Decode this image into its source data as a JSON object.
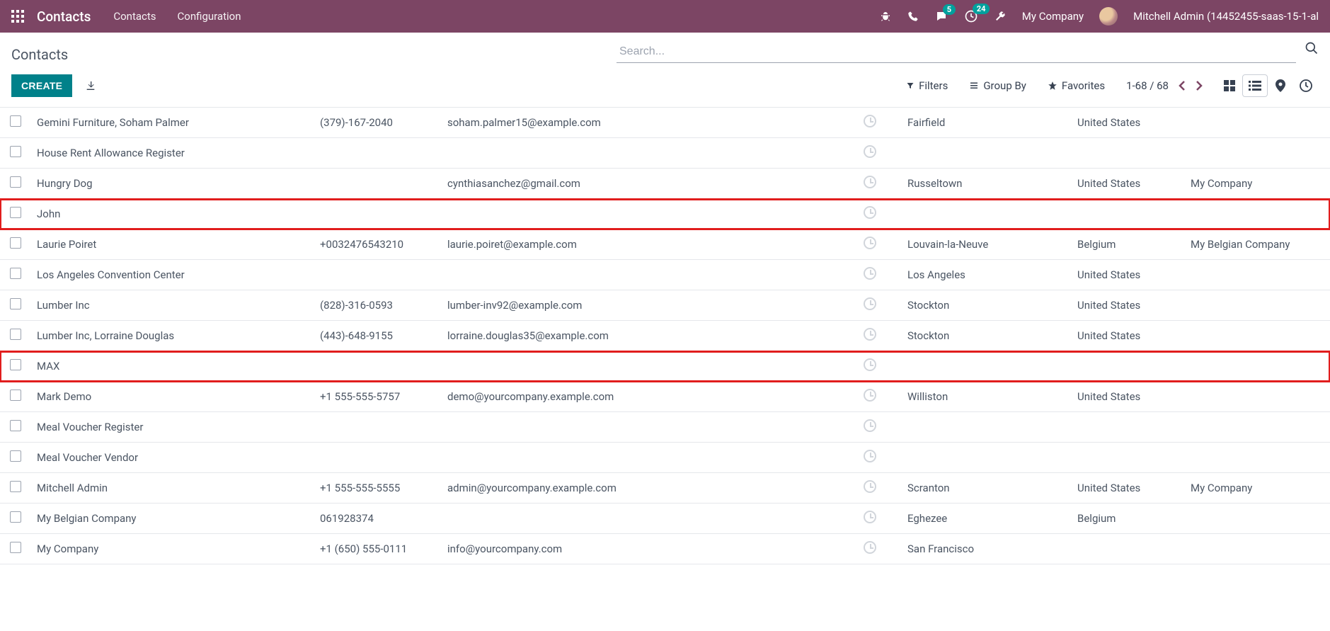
{
  "topbar": {
    "brand": "Contacts",
    "nav": {
      "contacts": "Contacts",
      "configuration": "Configuration"
    },
    "messaging_badge": "5",
    "activity_badge": "24",
    "company": "My Company",
    "user": "Mitchell Admin (14452455-saas-15-1-al"
  },
  "header": {
    "title": "Contacts",
    "search_placeholder": "Search..."
  },
  "toolbar": {
    "create": "CREATE",
    "filters": "Filters",
    "groupby": "Group By",
    "favorites": "Favorites",
    "pager": "1-68 / 68"
  },
  "rows": [
    {
      "name": "Gemini Furniture, Soham Palmer",
      "phone": "(379)-167-2040",
      "email": "soham.palmer15@example.com",
      "city": "Fairfield",
      "country": "United States",
      "company": "",
      "hl": false
    },
    {
      "name": "House Rent Allowance Register",
      "phone": "",
      "email": "",
      "city": "",
      "country": "",
      "company": "",
      "hl": false
    },
    {
      "name": "Hungry Dog",
      "phone": "",
      "email": "cynthiasanchez@gmail.com",
      "city": "Russeltown",
      "country": "United States",
      "company": "My Company",
      "hl": false
    },
    {
      "name": "John",
      "phone": "",
      "email": "",
      "city": "",
      "country": "",
      "company": "",
      "hl": true
    },
    {
      "name": "Laurie Poiret",
      "phone": "+0032476543210",
      "email": "laurie.poiret@example.com",
      "city": "Louvain-la-Neuve",
      "country": "Belgium",
      "company": "My Belgian Company",
      "hl": false
    },
    {
      "name": "Los Angeles Convention Center",
      "phone": "",
      "email": "",
      "city": "Los Angeles",
      "country": "United States",
      "company": "",
      "hl": false
    },
    {
      "name": "Lumber Inc",
      "phone": "(828)-316-0593",
      "email": "lumber-inv92@example.com",
      "city": "Stockton",
      "country": "United States",
      "company": "",
      "hl": false
    },
    {
      "name": "Lumber Inc, Lorraine Douglas",
      "phone": "(443)-648-9155",
      "email": "lorraine.douglas35@example.com",
      "city": "Stockton",
      "country": "United States",
      "company": "",
      "hl": false
    },
    {
      "name": "MAX",
      "phone": "",
      "email": "",
      "city": "",
      "country": "",
      "company": "",
      "hl": true
    },
    {
      "name": "Mark Demo",
      "phone": "+1 555-555-5757",
      "email": "demo@yourcompany.example.com",
      "city": "Williston",
      "country": "United States",
      "company": "",
      "hl": false
    },
    {
      "name": "Meal Voucher Register",
      "phone": "",
      "email": "",
      "city": "",
      "country": "",
      "company": "",
      "hl": false
    },
    {
      "name": "Meal Voucher Vendor",
      "phone": "",
      "email": "",
      "city": "",
      "country": "",
      "company": "",
      "hl": false
    },
    {
      "name": "Mitchell Admin",
      "phone": "+1 555-555-5555",
      "email": "admin@yourcompany.example.com",
      "city": "Scranton",
      "country": "United States",
      "company": "My Company",
      "hl": false
    },
    {
      "name": "My Belgian Company",
      "phone": "061928374",
      "email": "",
      "city": "Eghezee",
      "country": "Belgium",
      "company": "",
      "hl": false
    },
    {
      "name": "My Company",
      "phone": "+1 (650) 555-0111",
      "email": "info@yourcompany.com",
      "city": "San Francisco",
      "country": "",
      "company": "",
      "hl": false
    }
  ]
}
